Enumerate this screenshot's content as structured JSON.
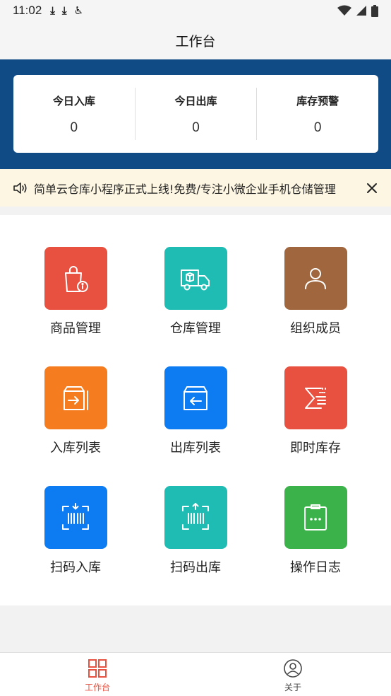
{
  "status_bar": {
    "time": "11:02",
    "left_icons": [
      "download-icon",
      "download-icon",
      "accessibility-icon"
    ],
    "right_icons": [
      "wifi-icon",
      "signal-icon",
      "battery-icon"
    ]
  },
  "nav": {
    "title": "工作台"
  },
  "summary": {
    "items": [
      {
        "label": "今日入库",
        "value": "0"
      },
      {
        "label": "今日出库",
        "value": "0"
      },
      {
        "label": "库存预警",
        "value": "0"
      }
    ]
  },
  "notice": {
    "text": "简单云仓库小程序正式上线!免费/专注小微企业手机仓储管理",
    "icon": "speaker-icon",
    "close_icon": "close-icon"
  },
  "grid": {
    "items": [
      {
        "label": "商品管理",
        "icon": "shopping-bag-info-icon",
        "color": "#e8503f"
      },
      {
        "label": "仓库管理",
        "icon": "delivery-truck-icon",
        "color": "#1fbcb4"
      },
      {
        "label": "组织成员",
        "icon": "person-icon",
        "color": "#a0663d"
      },
      {
        "label": "入库列表",
        "icon": "box-in-icon",
        "color": "#f57c1f"
      },
      {
        "label": "出库列表",
        "icon": "box-out-icon",
        "color": "#0d7cf2"
      },
      {
        "label": "即时库存",
        "icon": "sigma-list-icon",
        "color": "#e8503f"
      },
      {
        "label": "扫码入库",
        "icon": "scan-in-icon",
        "color": "#0d7cf2"
      },
      {
        "label": "扫码出库",
        "icon": "scan-out-icon",
        "color": "#1fbcb4"
      },
      {
        "label": "操作日志",
        "icon": "clipboard-icon",
        "color": "#3bb24a"
      }
    ]
  },
  "tabbar": {
    "items": [
      {
        "label": "工作台",
        "icon": "grid-icon",
        "active": true,
        "color": "#e8503f"
      },
      {
        "label": "关于",
        "icon": "user-circle-icon",
        "active": false,
        "color": "#444444"
      }
    ]
  },
  "colors": {
    "header_band": "#114b85",
    "notice_bg": "#fdf6e3",
    "accent": "#e8503f"
  }
}
